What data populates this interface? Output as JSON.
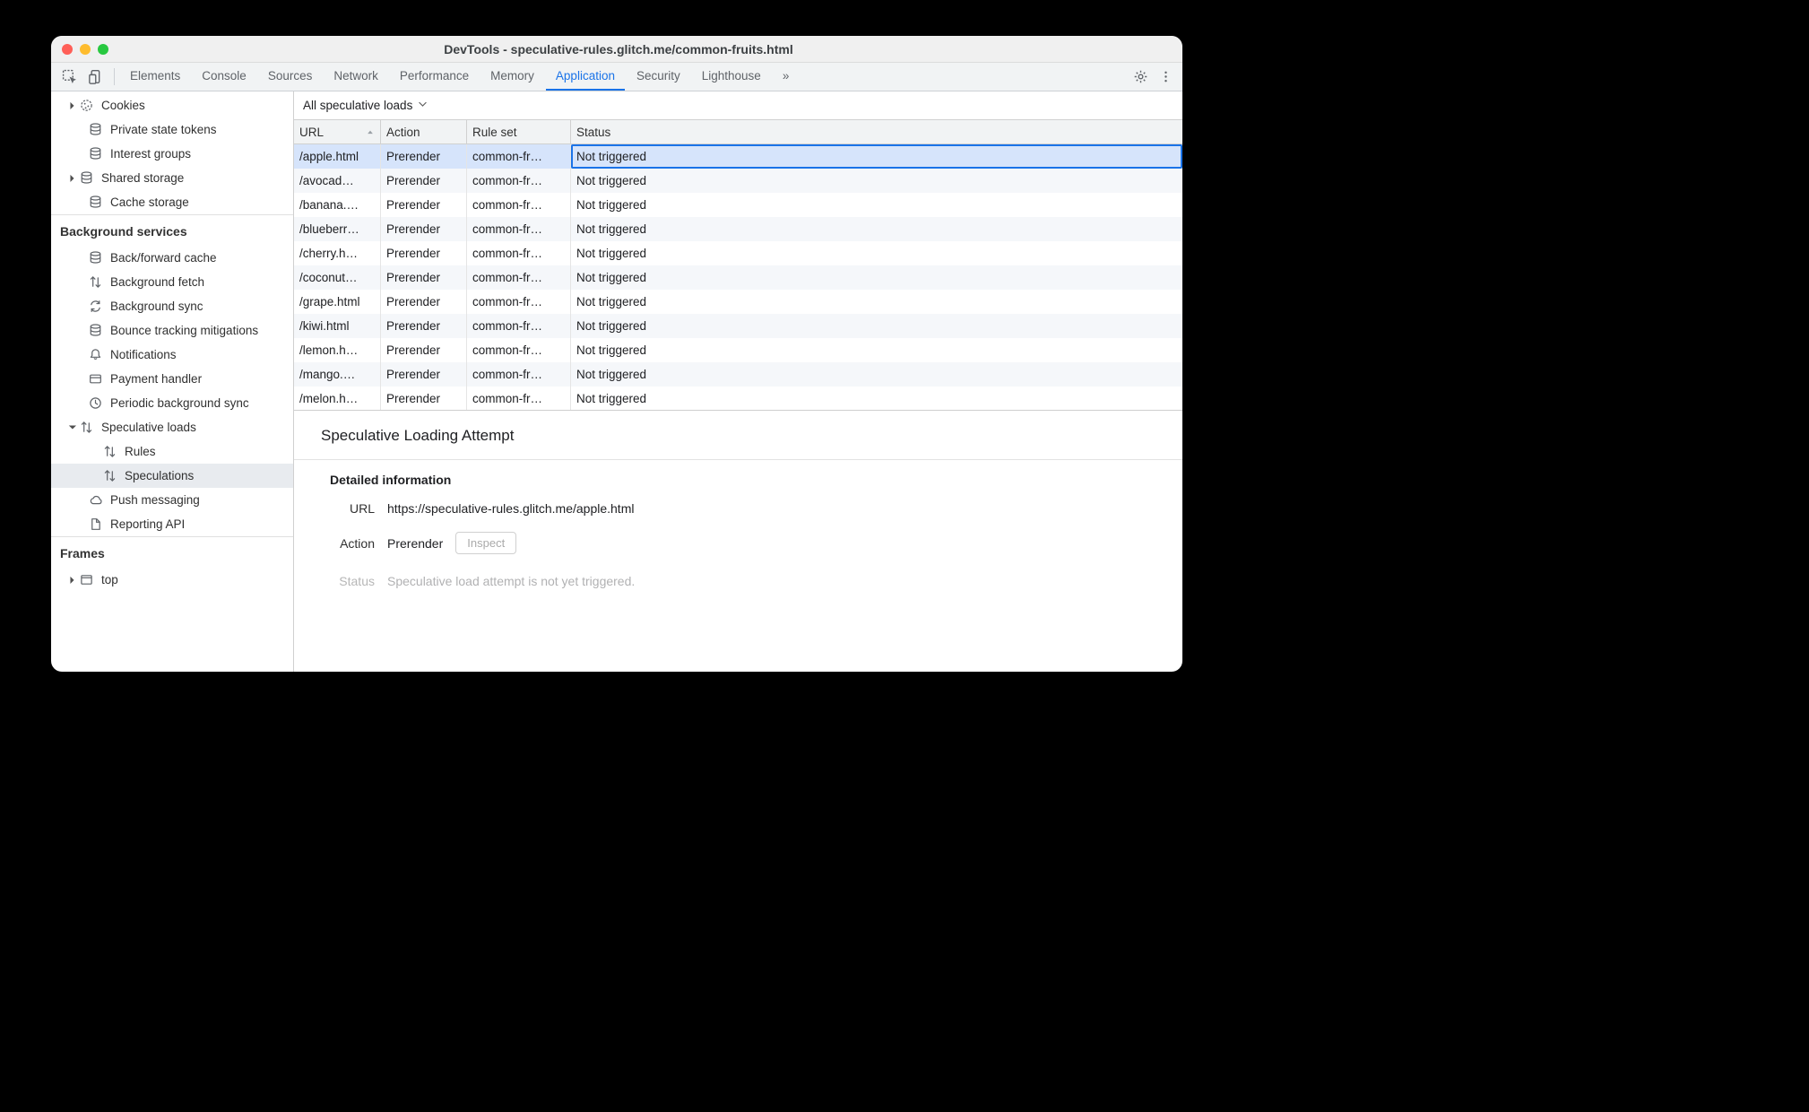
{
  "window": {
    "title": "DevTools - speculative-rules.glitch.me/common-fruits.html"
  },
  "tabs": {
    "items": [
      "Elements",
      "Console",
      "Sources",
      "Network",
      "Performance",
      "Memory",
      "Application",
      "Security",
      "Lighthouse"
    ],
    "active": "Application",
    "more": "»"
  },
  "sidebar": {
    "storage_group_visible_items": [
      {
        "label": "Cookies",
        "icon": "cookie",
        "arrow": "right",
        "indent": 18
      },
      {
        "label": "Private state tokens",
        "icon": "db",
        "arrow": "none",
        "indent": 28
      },
      {
        "label": "Interest groups",
        "icon": "db",
        "arrow": "none",
        "indent": 28
      },
      {
        "label": "Shared storage",
        "icon": "db",
        "arrow": "right",
        "indent": 18
      },
      {
        "label": "Cache storage",
        "icon": "db",
        "arrow": "none",
        "indent": 28
      }
    ],
    "bg_title": "Background services",
    "bg_items": [
      {
        "label": "Back/forward cache",
        "icon": "db",
        "indent": 28,
        "arrow": "none"
      },
      {
        "label": "Background fetch",
        "icon": "updown",
        "indent": 28,
        "arrow": "none"
      },
      {
        "label": "Background sync",
        "icon": "sync",
        "indent": 28,
        "arrow": "none"
      },
      {
        "label": "Bounce tracking mitigations",
        "icon": "db",
        "indent": 28,
        "arrow": "none"
      },
      {
        "label": "Notifications",
        "icon": "bell",
        "indent": 28,
        "arrow": "none"
      },
      {
        "label": "Payment handler",
        "icon": "card",
        "indent": 28,
        "arrow": "none"
      },
      {
        "label": "Periodic background sync",
        "icon": "clock",
        "indent": 28,
        "arrow": "none"
      },
      {
        "label": "Speculative loads",
        "icon": "updown",
        "indent": 18,
        "arrow": "down"
      },
      {
        "label": "Rules",
        "icon": "updown",
        "indent": 44,
        "arrow": "none"
      },
      {
        "label": "Speculations",
        "icon": "updown",
        "indent": 44,
        "arrow": "none",
        "selected": true
      },
      {
        "label": "Push messaging",
        "icon": "cloud",
        "indent": 28,
        "arrow": "none"
      },
      {
        "label": "Reporting API",
        "icon": "doc",
        "indent": 28,
        "arrow": "none"
      }
    ],
    "frames_title": "Frames",
    "frames_items": [
      {
        "label": "top",
        "icon": "frame",
        "indent": 18,
        "arrow": "right"
      }
    ]
  },
  "filter": {
    "label": "All speculative loads"
  },
  "grid": {
    "headers": {
      "url": "URL",
      "action": "Action",
      "rule": "Rule set",
      "status": "Status"
    },
    "rows": [
      {
        "url": "/apple.html",
        "action": "Prerender",
        "rule": "common-fr…",
        "status": "Not triggered",
        "selected": true
      },
      {
        "url": "/avocad…",
        "action": "Prerender",
        "rule": "common-fr…",
        "status": "Not triggered"
      },
      {
        "url": "/banana.…",
        "action": "Prerender",
        "rule": "common-fr…",
        "status": "Not triggered"
      },
      {
        "url": "/blueberr…",
        "action": "Prerender",
        "rule": "common-fr…",
        "status": "Not triggered"
      },
      {
        "url": "/cherry.h…",
        "action": "Prerender",
        "rule": "common-fr…",
        "status": "Not triggered"
      },
      {
        "url": "/coconut…",
        "action": "Prerender",
        "rule": "common-fr…",
        "status": "Not triggered"
      },
      {
        "url": "/grape.html",
        "action": "Prerender",
        "rule": "common-fr…",
        "status": "Not triggered"
      },
      {
        "url": "/kiwi.html",
        "action": "Prerender",
        "rule": "common-fr…",
        "status": "Not triggered"
      },
      {
        "url": "/lemon.h…",
        "action": "Prerender",
        "rule": "common-fr…",
        "status": "Not triggered"
      },
      {
        "url": "/mango.…",
        "action": "Prerender",
        "rule": "common-fr…",
        "status": "Not triggered"
      },
      {
        "url": "/melon.h…",
        "action": "Prerender",
        "rule": "common-fr…",
        "status": "Not triggered"
      }
    ]
  },
  "detail": {
    "heading": "Speculative Loading Attempt",
    "info_title": "Detailed information",
    "url_label": "URL",
    "url_value": "https://speculative-rules.glitch.me/apple.html",
    "action_label": "Action",
    "action_value": "Prerender",
    "inspect_label": "Inspect",
    "status_label": "Status",
    "status_value": "Speculative load attempt is not yet triggered."
  }
}
